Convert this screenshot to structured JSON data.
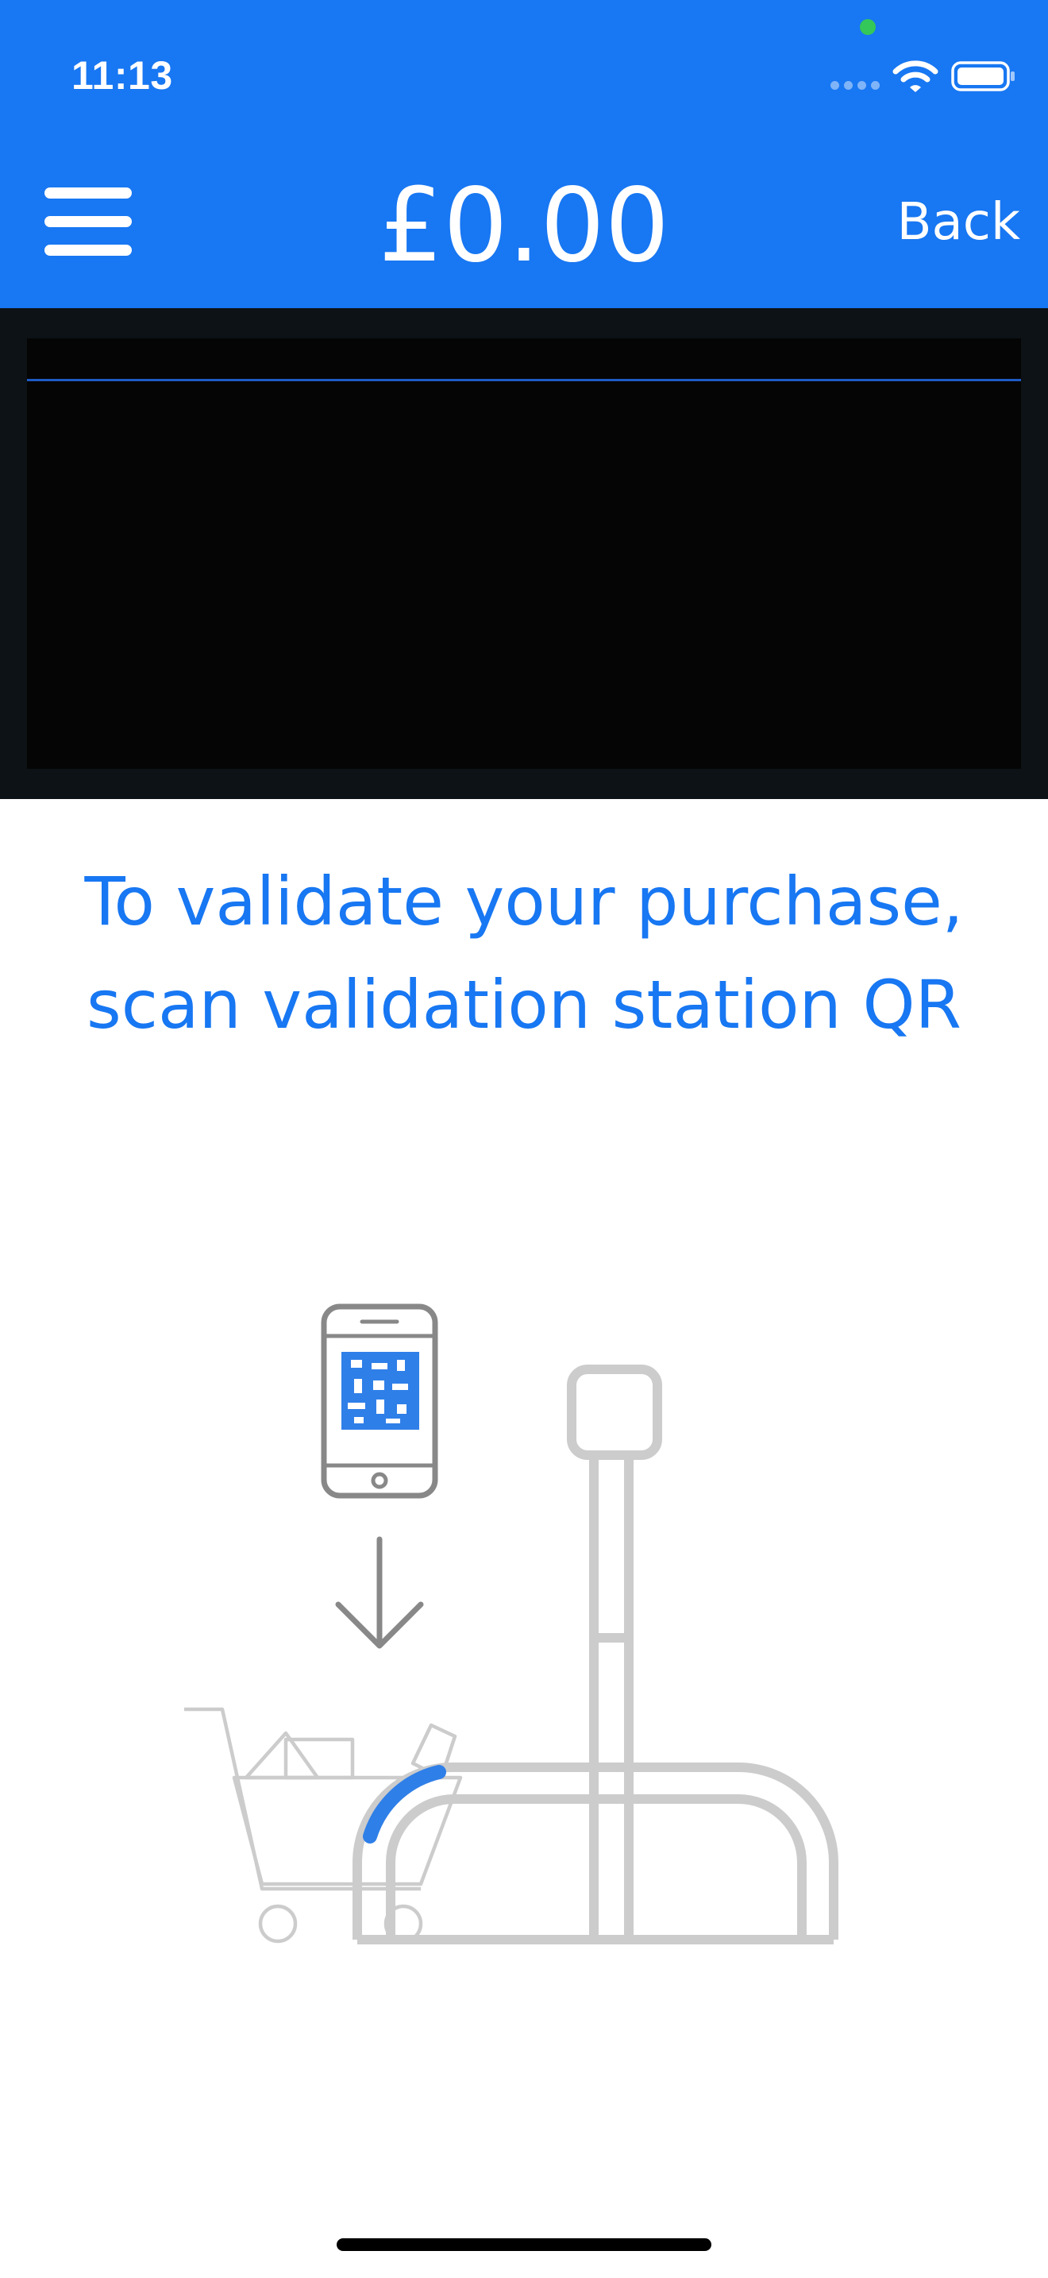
{
  "status_bar": {
    "time": "11:13",
    "icons": [
      "camera-indicator-dot",
      "cellular-signal-icon",
      "wifi-icon",
      "battery-icon"
    ],
    "camera_indicator_color": "#34C759"
  },
  "header": {
    "menu_icon": "hamburger-menu-icon",
    "balance": "£0.00",
    "back_label": "Back",
    "background_color": "#1877F2"
  },
  "scanner": {
    "scan_line_color": "#1e5ac4"
  },
  "instruction": {
    "text": "To validate your purchase, scan validation station QR",
    "color": "#1877F2"
  },
  "illustration": {
    "icons": [
      "phone-qr-icon",
      "down-arrow-icon",
      "shopping-cart-icon",
      "validation-station-icon"
    ],
    "accent_color": "#2F7FE8",
    "line_color": "#CCCCCC"
  }
}
